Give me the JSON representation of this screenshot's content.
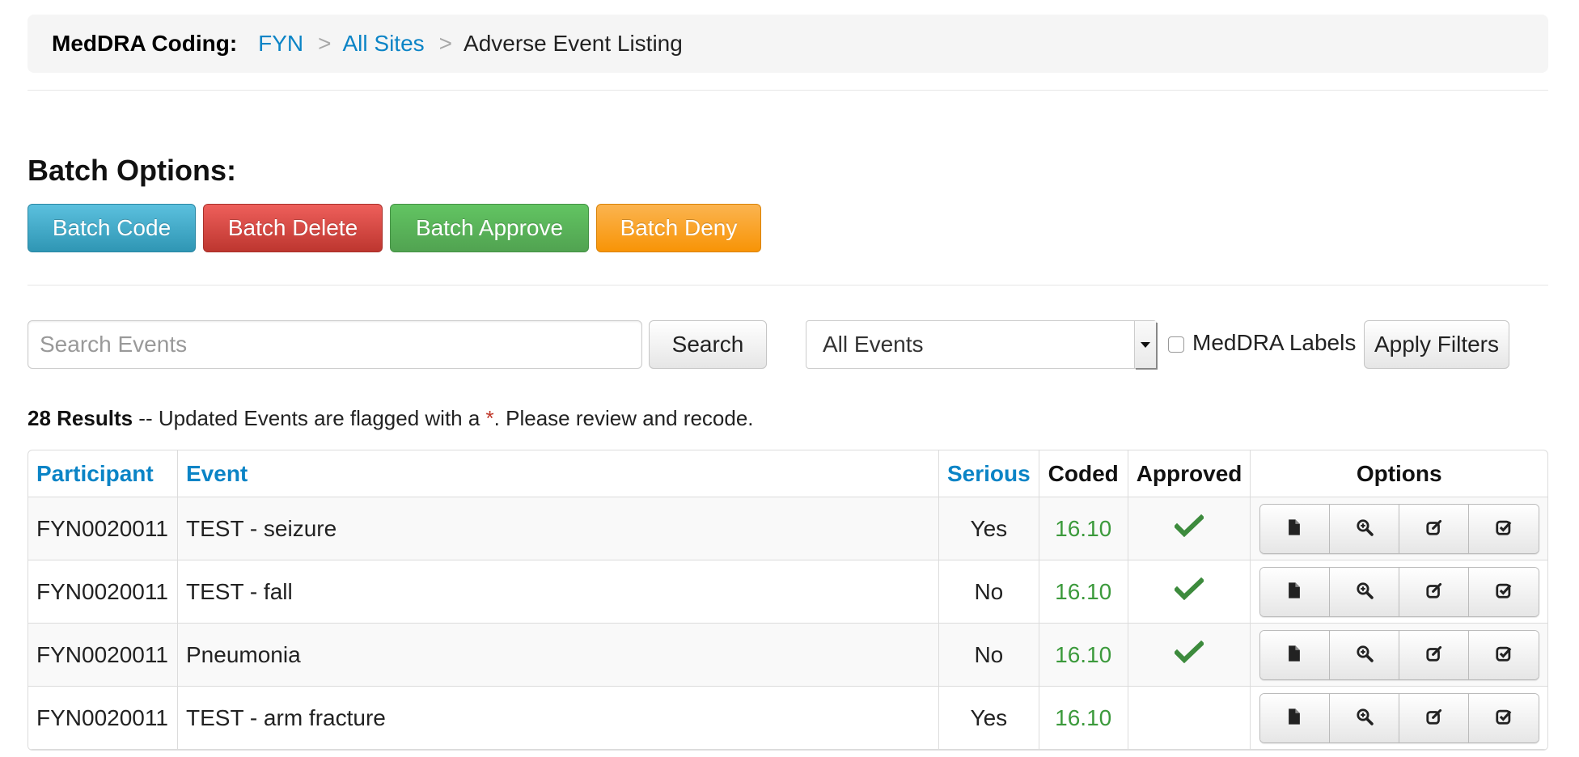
{
  "breadcrumb": {
    "title": "MedDRA Coding:",
    "links": [
      "FYN",
      "All Sites"
    ],
    "separator": ">",
    "current": "Adverse Event Listing"
  },
  "batch": {
    "heading": "Batch Options:",
    "buttons": {
      "code": "Batch Code",
      "delete": "Batch Delete",
      "approve": "Batch Approve",
      "deny": "Batch Deny"
    }
  },
  "filters": {
    "search_placeholder": "Search Events",
    "search_button": "Search",
    "select_value": "All Events",
    "checkbox_label": "MedDRA Labels",
    "apply_button": "Apply Filters"
  },
  "results": {
    "count_text": "28 Results",
    "message_before": " -- Updated Events are flagged with a ",
    "asterisk": "*",
    "message_after": ". Please review and recode."
  },
  "table": {
    "headers": {
      "participant": "Participant",
      "event": "Event",
      "serious": "Serious",
      "coded": "Coded",
      "approved": "Approved",
      "options": "Options"
    },
    "rows": [
      {
        "participant": "FYN0020011",
        "event": "TEST - seizure",
        "serious": "Yes",
        "coded": "16.10",
        "approved": true
      },
      {
        "participant": "FYN0020011",
        "event": "TEST - fall",
        "serious": "No",
        "coded": "16.10",
        "approved": true
      },
      {
        "participant": "FYN0020011",
        "event": "Pneumonia",
        "serious": "No",
        "coded": "16.10",
        "approved": true
      },
      {
        "participant": "FYN0020011",
        "event": "TEST - arm fracture",
        "serious": "Yes",
        "coded": "16.10",
        "approved": false
      }
    ],
    "option_icons": [
      "file-icon",
      "zoom-in-icon",
      "edit-icon",
      "check-square-icon"
    ]
  },
  "colors": {
    "link": "#0b84c6",
    "coded": "#3c9a3c",
    "approved_check": "#3d8b3d",
    "asterisk": "#c0392b"
  }
}
